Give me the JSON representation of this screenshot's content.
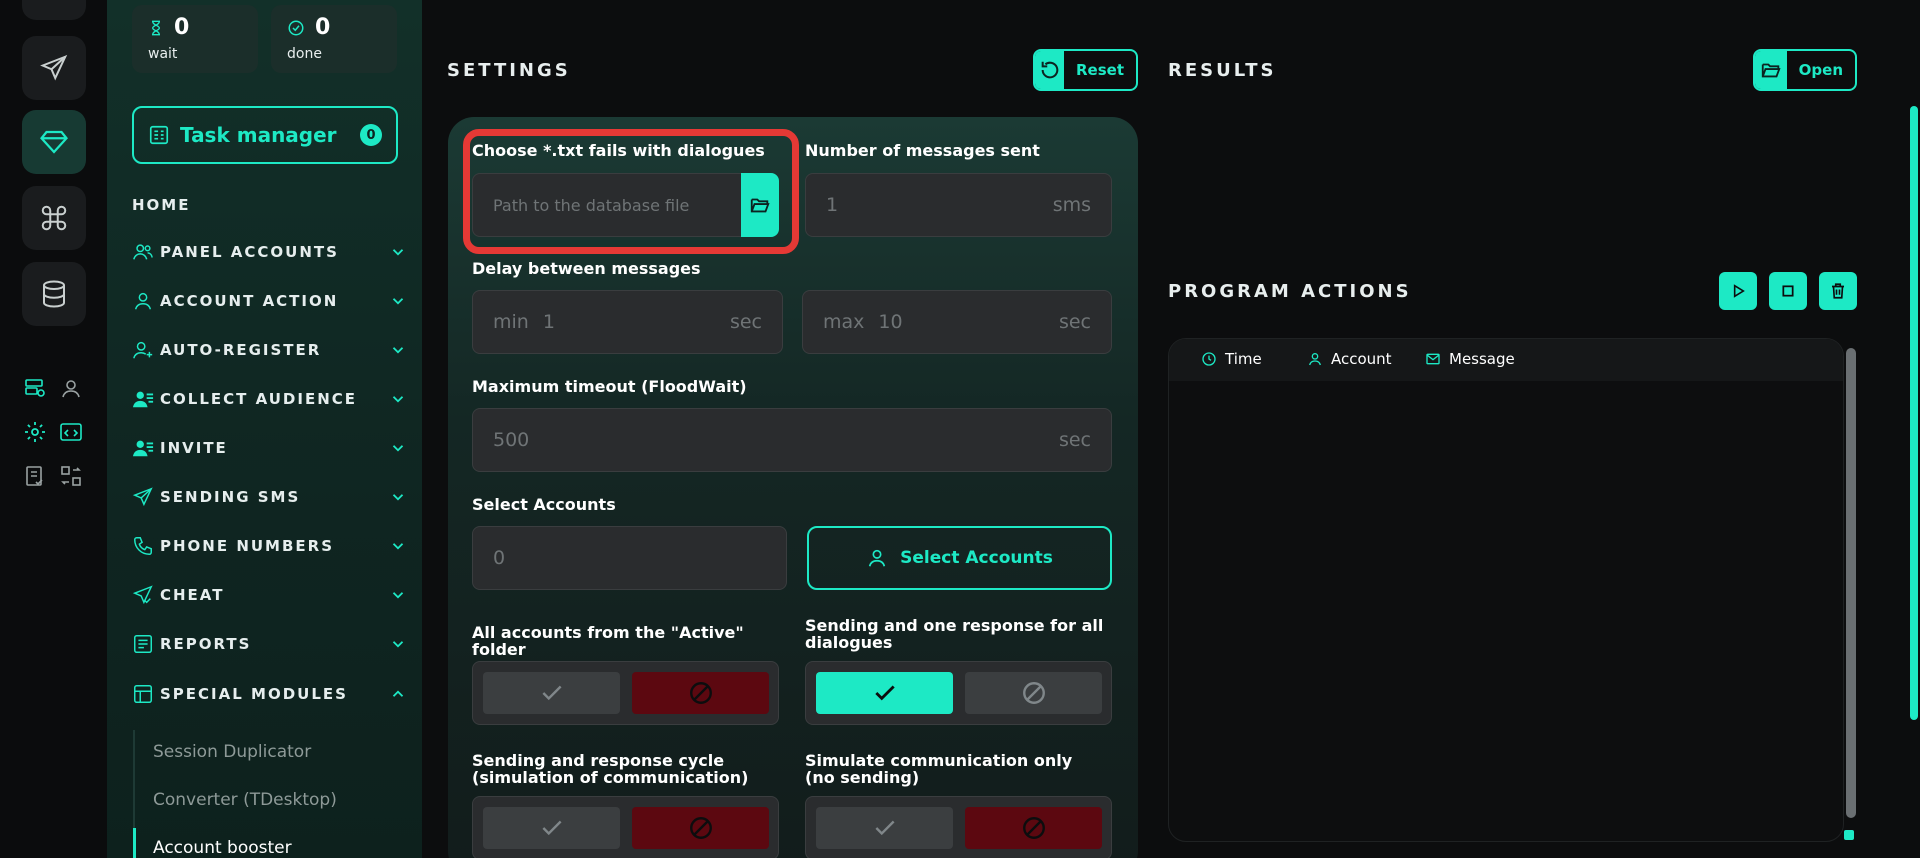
{
  "colors": {
    "accent": "#1de9c5",
    "danger": "#e53935",
    "toggle_off_red": "#5c0810"
  },
  "stats": {
    "wait": {
      "value": "0",
      "label": "wait",
      "icon": "hourglass-icon"
    },
    "done": {
      "value": "0",
      "label": "done",
      "icon": "check-circle-icon"
    }
  },
  "task_manager": {
    "label": "Task manager",
    "count": "0"
  },
  "nav": {
    "home": "HOME",
    "items": [
      {
        "label": "PANEL ACCOUNTS",
        "icon": "users-icon",
        "expanded": false
      },
      {
        "label": "ACCOUNT ACTION",
        "icon": "user-icon",
        "expanded": false
      },
      {
        "label": "AUTO-REGISTER",
        "icon": "user-plus-icon",
        "expanded": false
      },
      {
        "label": "COLLECT AUDIENCE",
        "icon": "user-list-icon",
        "expanded": false
      },
      {
        "label": "INVITE",
        "icon": "user-list-icon",
        "expanded": false
      },
      {
        "label": "SENDING SMS",
        "icon": "send-icon",
        "expanded": false
      },
      {
        "label": "PHONE NUMBERS",
        "icon": "phone-icon",
        "expanded": false
      },
      {
        "label": "CHEAT",
        "icon": "send-check-icon",
        "expanded": false
      },
      {
        "label": "REPORTS",
        "icon": "report-icon",
        "expanded": false
      },
      {
        "label": "SPECIAL MODULES",
        "icon": "module-icon",
        "expanded": true
      }
    ],
    "sub_items": [
      "Session Duplicator",
      "Converter (TDesktop)",
      "Account booster"
    ],
    "active_sub": "Account booster"
  },
  "settings": {
    "title": "SETTINGS",
    "reset_label": "Reset",
    "dialogues_file": {
      "label": "Choose *.txt fails with dialogues",
      "placeholder": "Path to the database file"
    },
    "messages_sent": {
      "label": "Number of messages sent",
      "value": "1",
      "unit": "sms"
    },
    "delay": {
      "label": "Delay between messages",
      "min_prefix": "min",
      "min_value": "1",
      "max_prefix": "max",
      "max_value": "10",
      "unit": "sec"
    },
    "timeout": {
      "label": "Maximum timeout (FloodWait)",
      "value": "500",
      "unit": "sec"
    },
    "accounts": {
      "label": "Select Accounts",
      "value": "0",
      "button": "Select Accounts"
    },
    "toggles": [
      {
        "label": "All accounts from the \"Active\" folder",
        "enabled": false
      },
      {
        "label": "Sending and one response for all dialogues",
        "enabled": true
      },
      {
        "label": "Sending and response cycle (simulation of communication)",
        "enabled": false
      },
      {
        "label": "Simulate communication only (no sending)",
        "enabled": false
      }
    ]
  },
  "results": {
    "title": "RESULTS",
    "open_label": "Open"
  },
  "program_actions": {
    "title": "PROGRAM ACTIONS",
    "columns": [
      {
        "label": "Time",
        "icon": "clock-icon"
      },
      {
        "label": "Account",
        "icon": "user-icon"
      },
      {
        "label": "Message",
        "icon": "mail-icon"
      }
    ]
  }
}
